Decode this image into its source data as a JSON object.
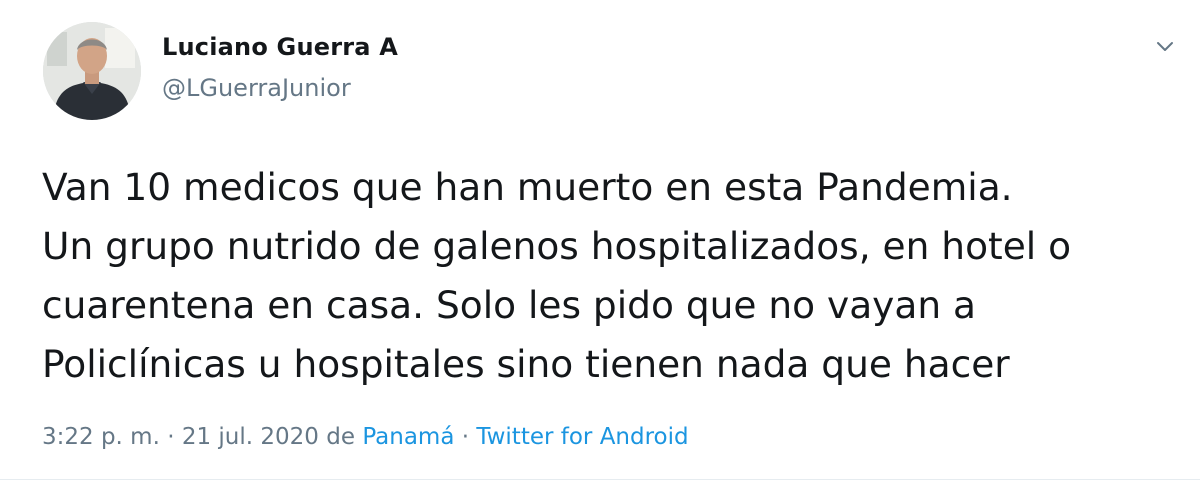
{
  "author": {
    "display_name": "Luciano Guerra A",
    "handle": "@LGuerraJunior",
    "avatar_icon": "profile-photo"
  },
  "menu": {
    "icon": "chevron-down-icon"
  },
  "tweet": {
    "lines": [
      "Van 10 medicos que han muerto en esta Pandemia.",
      "Un grupo nutrido de galenos hospitalizados, en hotel o",
      "cuarentena en casa. Solo les pido que no vayan a",
      "Policlínicas u hospitales sino tienen nada que hacer"
    ]
  },
  "meta": {
    "time": "3:22 p. m.",
    "separator": "·",
    "date": "21 jul. 2020",
    "from_word": "de",
    "location": "Panamá",
    "source": "Twitter for Android"
  },
  "colors": {
    "text": "#14171a",
    "secondary": "#657786",
    "link": "#1b95e0"
  }
}
